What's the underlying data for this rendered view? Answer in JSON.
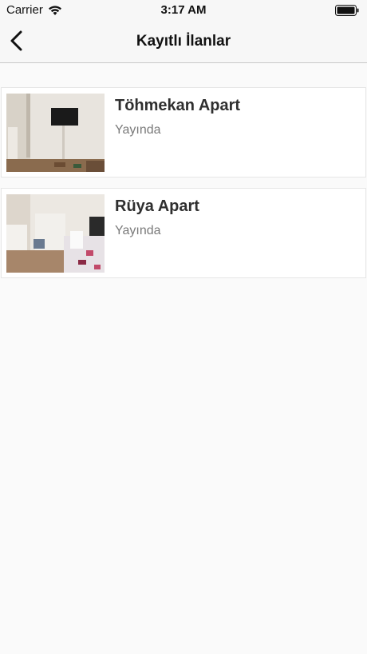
{
  "status_bar": {
    "carrier": "Carrier",
    "time": "3:17 AM"
  },
  "nav": {
    "title": "Kayıtlı İlanlar",
    "back_icon": "chevron-left-icon"
  },
  "listings": [
    {
      "title": "Töhmekan Apart",
      "status": "Yayında"
    },
    {
      "title": "Rüya Apart",
      "status": "Yayında"
    }
  ],
  "colors": {
    "background": "#fafafa",
    "card": "#ffffff",
    "title_text": "#2f2f2f",
    "status_text": "#7a7a7a"
  }
}
